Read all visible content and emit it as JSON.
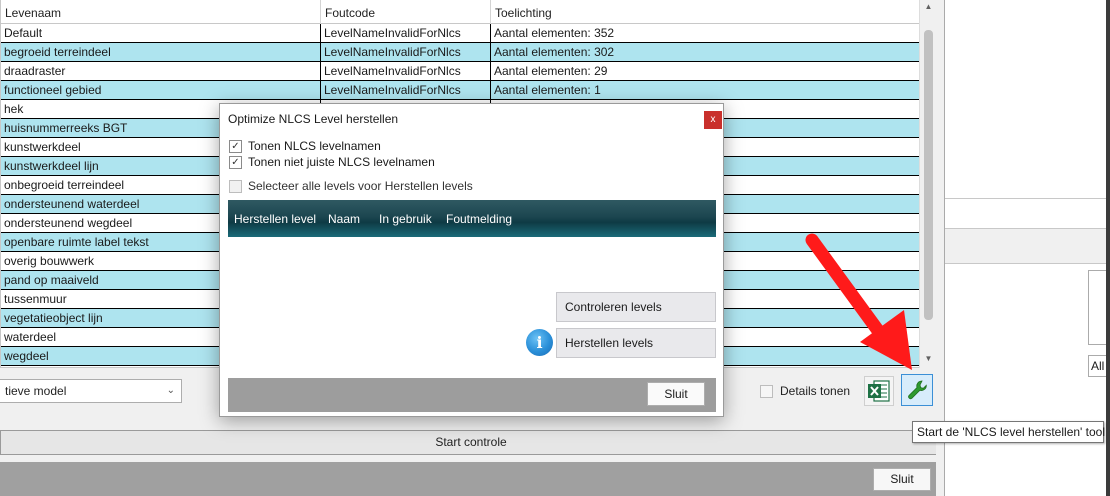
{
  "grid": {
    "headers": [
      "Levenaam",
      "Foutcode",
      "Toelichting"
    ],
    "rows": [
      {
        "name": "Default",
        "code": "LevelNameInvalidForNlcs",
        "note": "Aantal elementen: 352"
      },
      {
        "name": "begroeid terreindeel",
        "code": "LevelNameInvalidForNlcs",
        "note": "Aantal elementen: 302"
      },
      {
        "name": "draadraster",
        "code": "LevelNameInvalidForNlcs",
        "note": "Aantal elementen: 29"
      },
      {
        "name": "functioneel gebied",
        "code": "LevelNameInvalidForNlcs",
        "note": "Aantal elementen: 1"
      },
      {
        "name": "hek",
        "code": "",
        "note": ""
      },
      {
        "name": "huisnummerreeks BGT",
        "code": "",
        "note": ""
      },
      {
        "name": "kunstwerkdeel",
        "code": "",
        "note": ""
      },
      {
        "name": "kunstwerkdeel lijn",
        "code": "",
        "note": ""
      },
      {
        "name": "onbegroeid terreindeel",
        "code": "",
        "note": ""
      },
      {
        "name": "ondersteunend waterdeel",
        "code": "",
        "note": ""
      },
      {
        "name": "ondersteunend wegdeel",
        "code": "",
        "note": ""
      },
      {
        "name": "openbare ruimte label tekst",
        "code": "",
        "note": ""
      },
      {
        "name": "overig bouwwerk",
        "code": "",
        "note": ""
      },
      {
        "name": "pand op maaiveld",
        "code": "",
        "note": ""
      },
      {
        "name": "tussenmuur",
        "code": "",
        "note": ""
      },
      {
        "name": "vegetatieobject lijn",
        "code": "",
        "note": ""
      },
      {
        "name": "waterdeel",
        "code": "",
        "note": ""
      },
      {
        "name": "wegdeel",
        "code": "",
        "note": ""
      }
    ]
  },
  "toolbar": {
    "model_select": "tieve model",
    "details_label": "Details tonen",
    "excel_icon": "excel-icon",
    "wrench_icon": "wrench-icon",
    "start_label": "Start controle",
    "sluit_label": "Sluit",
    "all_label": "All"
  },
  "tooltip": "Start de 'NLCS level herstellen' tool",
  "dialog": {
    "title": "Optimize NLCS Level herstellen",
    "close_glyph": "x",
    "checkboxes": [
      {
        "label": "Tonen NLCS levelnamen",
        "checked": true
      },
      {
        "label": "Tonen niet juiste NLCS levelnamen",
        "checked": true
      },
      {
        "label": "Selecteer alle levels voor Herstellen levels",
        "checked": false
      }
    ],
    "columns": [
      "Herstellen level",
      "Naam",
      "In gebruik",
      "Foutmelding"
    ],
    "controleren_label": "Controleren levels",
    "herstellen_label": "Herstellen levels",
    "info_glyph": "i",
    "sluit_label": "Sluit"
  },
  "colors": {
    "row_alt": "#aee4ef",
    "accent_arrow": "#ff1a1a",
    "close_red": "#c9302c"
  }
}
